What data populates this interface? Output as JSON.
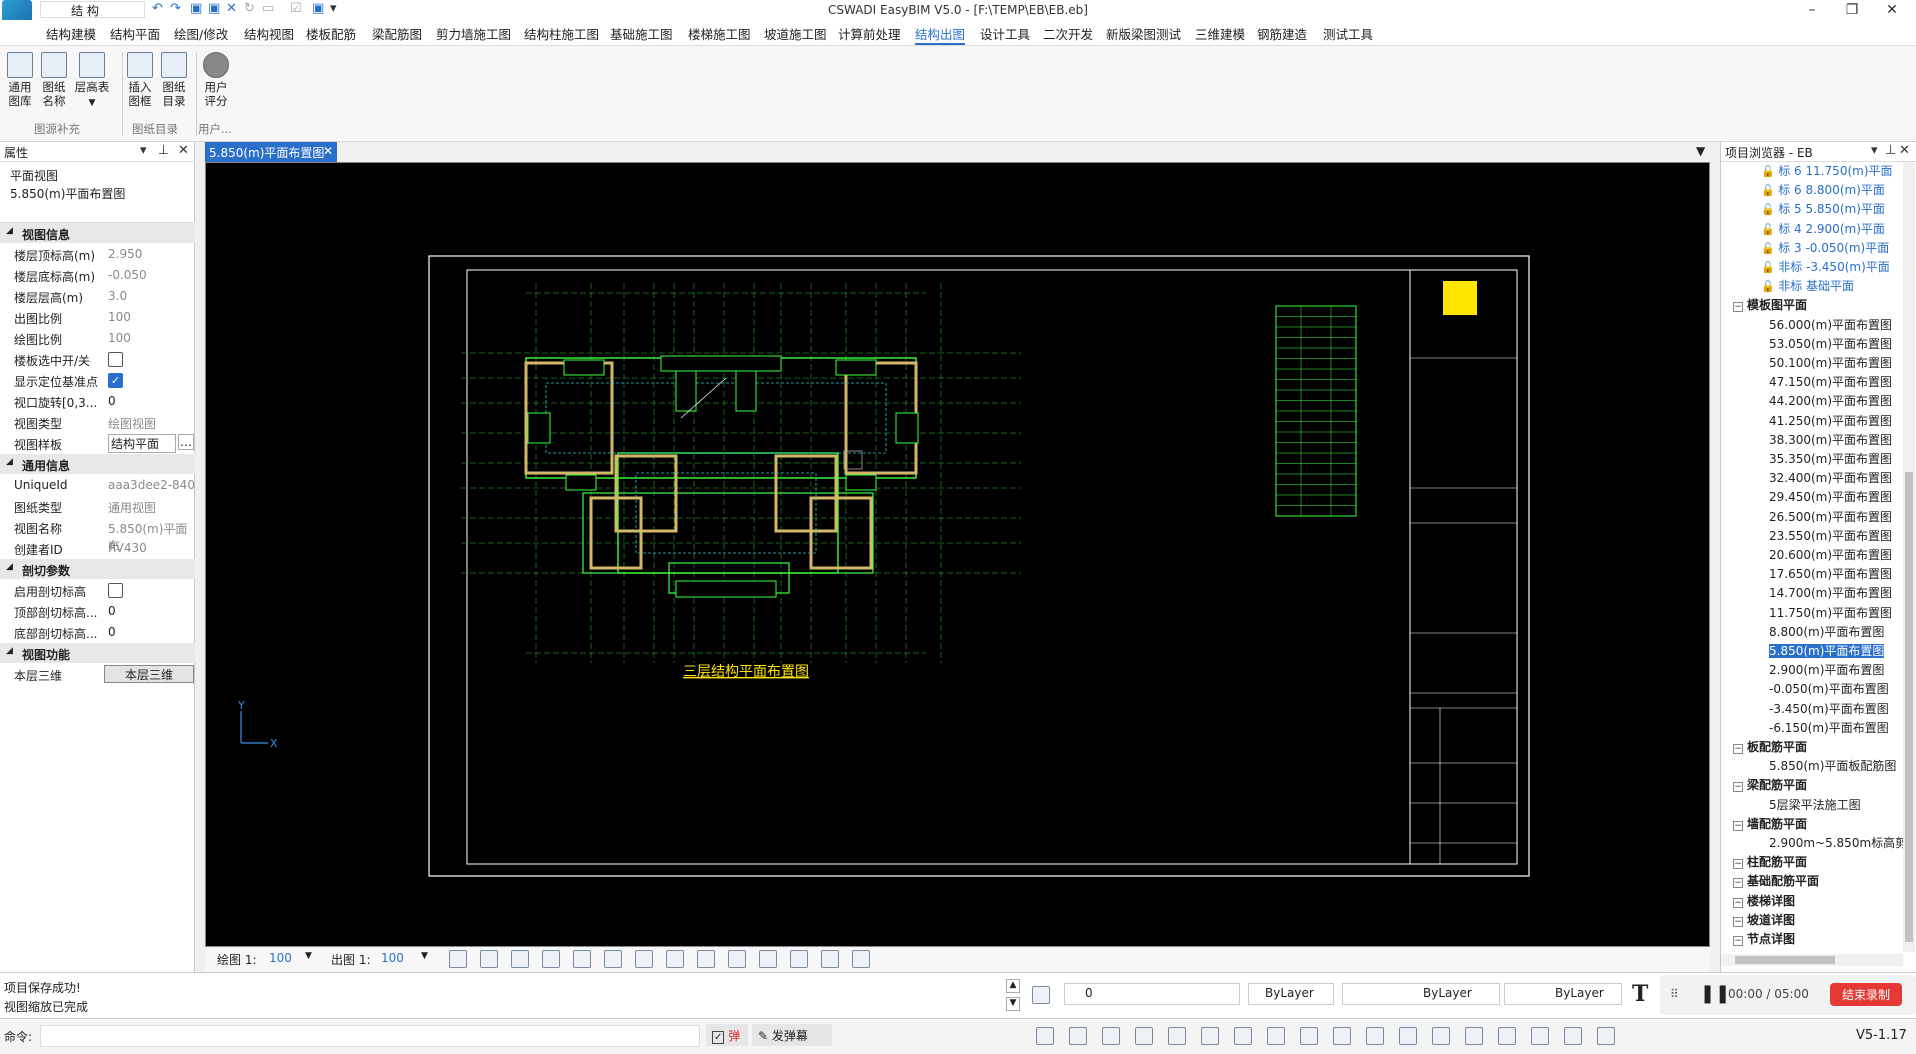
{
  "app": {
    "title": "CSWADI EasyBIM V5.0 - [F:\\TEMP\\EB\\EB.eb]",
    "combo": "结  构"
  },
  "menu": [
    "结构建模",
    "结构平面",
    "绘图/修改",
    "结构视图",
    "楼板配筋",
    "梁配筋图",
    "剪力墙施工图",
    "结构柱施工图",
    "基础施工图",
    "楼梯施工图",
    "坡道施工图",
    "计算前处理",
    "结构出图",
    "设计工具",
    "二次开发",
    "新版梁图测试",
    "三维建模",
    "钢筋建造",
    "测试工具"
  ],
  "menu_active": "结构出图",
  "ribbon": {
    "buttons": [
      "通用\n图库",
      "图纸\n名称",
      "层高表",
      "插入\n图框",
      "图纸\n目录",
      "用户\n评分"
    ],
    "groups": [
      "图源补充",
      "图纸目录",
      "用户..."
    ]
  },
  "props": {
    "header": "属性",
    "type": "平面视图",
    "name": "5.850(m)平面布置图",
    "rows": [
      {
        "k": "视图信息",
        "sec": true
      },
      {
        "k": "楼层顶标高(m)",
        "v": "2.950"
      },
      {
        "k": "楼层底标高(m)",
        "v": "-0.050"
      },
      {
        "k": "楼层层高(m)",
        "v": "3.0"
      },
      {
        "k": "出图比例",
        "v": "100"
      },
      {
        "k": "绘图比例",
        "v": "100"
      },
      {
        "k": "楼板选中开/关",
        "cb": false
      },
      {
        "k": "显示定位基准点",
        "cb": true
      },
      {
        "k": "视口旋转[0,3...",
        "v": "0"
      },
      {
        "k": "视图类型",
        "v": "绘图视图"
      },
      {
        "k": "视图样板",
        "v": "结构平面"
      },
      {
        "k": "通用信息",
        "sec": true
      },
      {
        "k": "UniqueId",
        "v": "aaa3dee2-840"
      },
      {
        "k": "图纸类型",
        "v": "通用视图"
      },
      {
        "k": "视图名称",
        "v": "5.850(m)平面布"
      },
      {
        "k": "创建者ID",
        "v": "RV430"
      },
      {
        "k": "剖切参数",
        "sec": true
      },
      {
        "k": "启用剖切标高",
        "cb": false
      },
      {
        "k": "顶部剖切标高...",
        "v": "0"
      },
      {
        "k": "底部剖切标高...",
        "v": "0"
      },
      {
        "k": "视图功能",
        "sec": true
      },
      {
        "k": "本层三维",
        "btn": "本层三维"
      }
    ]
  },
  "tab": "5.850(m)平面布置图",
  "drawing": {
    "title": "三层结构平面布置图",
    "axis_y": "Y",
    "axis_x": "X"
  },
  "bottom": {
    "draw_scale_label": "绘图 1:",
    "draw_scale": "100",
    "out_scale_label": "出图 1:",
    "out_scale": "100"
  },
  "browser": {
    "header": "项目浏览器 - EB",
    "items": [
      {
        "t": "标 6 11.750(m)平面",
        "lvl": 3,
        "lk": true
      },
      {
        "t": "标 6 8.800(m)平面",
        "lvl": 3,
        "lk": true
      },
      {
        "t": "标 5 5.850(m)平面",
        "lvl": 3,
        "lk": true
      },
      {
        "t": "标 4 2.900(m)平面",
        "lvl": 3,
        "lk": true
      },
      {
        "t": "标 3 -0.050(m)平面",
        "lvl": 3,
        "lk": true
      },
      {
        "t": "非标 -3.450(m)平面",
        "lvl": 3,
        "lk": true
      },
      {
        "t": "非标 基础平面",
        "lvl": 3,
        "lk": true
      },
      {
        "t": "模板图平面",
        "lvl": 1,
        "bold": true
      },
      {
        "t": "56.000(m)平面布置图",
        "lvl": 2
      },
      {
        "t": "53.050(m)平面布置图",
        "lvl": 2
      },
      {
        "t": "50.100(m)平面布置图",
        "lvl": 2
      },
      {
        "t": "47.150(m)平面布置图",
        "lvl": 2
      },
      {
        "t": "44.200(m)平面布置图",
        "lvl": 2
      },
      {
        "t": "41.250(m)平面布置图",
        "lvl": 2
      },
      {
        "t": "38.300(m)平面布置图",
        "lvl": 2
      },
      {
        "t": "35.350(m)平面布置图",
        "lvl": 2
      },
      {
        "t": "32.400(m)平面布置图",
        "lvl": 2
      },
      {
        "t": "29.450(m)平面布置图",
        "lvl": 2
      },
      {
        "t": "26.500(m)平面布置图",
        "lvl": 2
      },
      {
        "t": "23.550(m)平面布置图",
        "lvl": 2
      },
      {
        "t": "20.600(m)平面布置图",
        "lvl": 2
      },
      {
        "t": "17.650(m)平面布置图",
        "lvl": 2
      },
      {
        "t": "14.700(m)平面布置图",
        "lvl": 2
      },
      {
        "t": "11.750(m)平面布置图",
        "lvl": 2
      },
      {
        "t": "8.800(m)平面布置图",
        "lvl": 2
      },
      {
        "t": "5.850(m)平面布置图",
        "lvl": 2,
        "sel": true
      },
      {
        "t": "2.900(m)平面布置图",
        "lvl": 2
      },
      {
        "t": "-0.050(m)平面布置图",
        "lvl": 2
      },
      {
        "t": "-3.450(m)平面布置图",
        "lvl": 2
      },
      {
        "t": "-6.150(m)平面布置图",
        "lvl": 2
      },
      {
        "t": "板配筋平面",
        "lvl": 1,
        "bold": true
      },
      {
        "t": "5.850(m)平面板配筋图",
        "lvl": 2
      },
      {
        "t": "梁配筋平面",
        "lvl": 1,
        "bold": true
      },
      {
        "t": "5层梁平法施工图",
        "lvl": 2
      },
      {
        "t": "墙配筋平面",
        "lvl": 1,
        "bold": true
      },
      {
        "t": "2.900m~5.850m标高剪力",
        "lvl": 2
      },
      {
        "t": "柱配筋平面",
        "lvl": 1,
        "bold": true
      },
      {
        "t": "基础配筋平面",
        "lvl": 1,
        "bold": true
      },
      {
        "t": "楼梯详图",
        "lvl": 1,
        "bold": true
      },
      {
        "t": "坡道详图",
        "lvl": 1,
        "bold": true
      },
      {
        "t": "节点详图",
        "lvl": 1,
        "bold": true
      }
    ]
  },
  "status": {
    "line1": "项目保存成功!",
    "line2": "视图缩放已完成",
    "layer": "0",
    "bylayer1": "ByLayer",
    "bylayer2": "ByLayer",
    "bylayer3": "ByLayer",
    "timer": "00:00 / 05:00",
    "rec": "结束录制"
  },
  "cmd": {
    "label": "命令:",
    "toggle1": "弹",
    "toggle2": "发弹幕",
    "version": "V5-1.17"
  }
}
